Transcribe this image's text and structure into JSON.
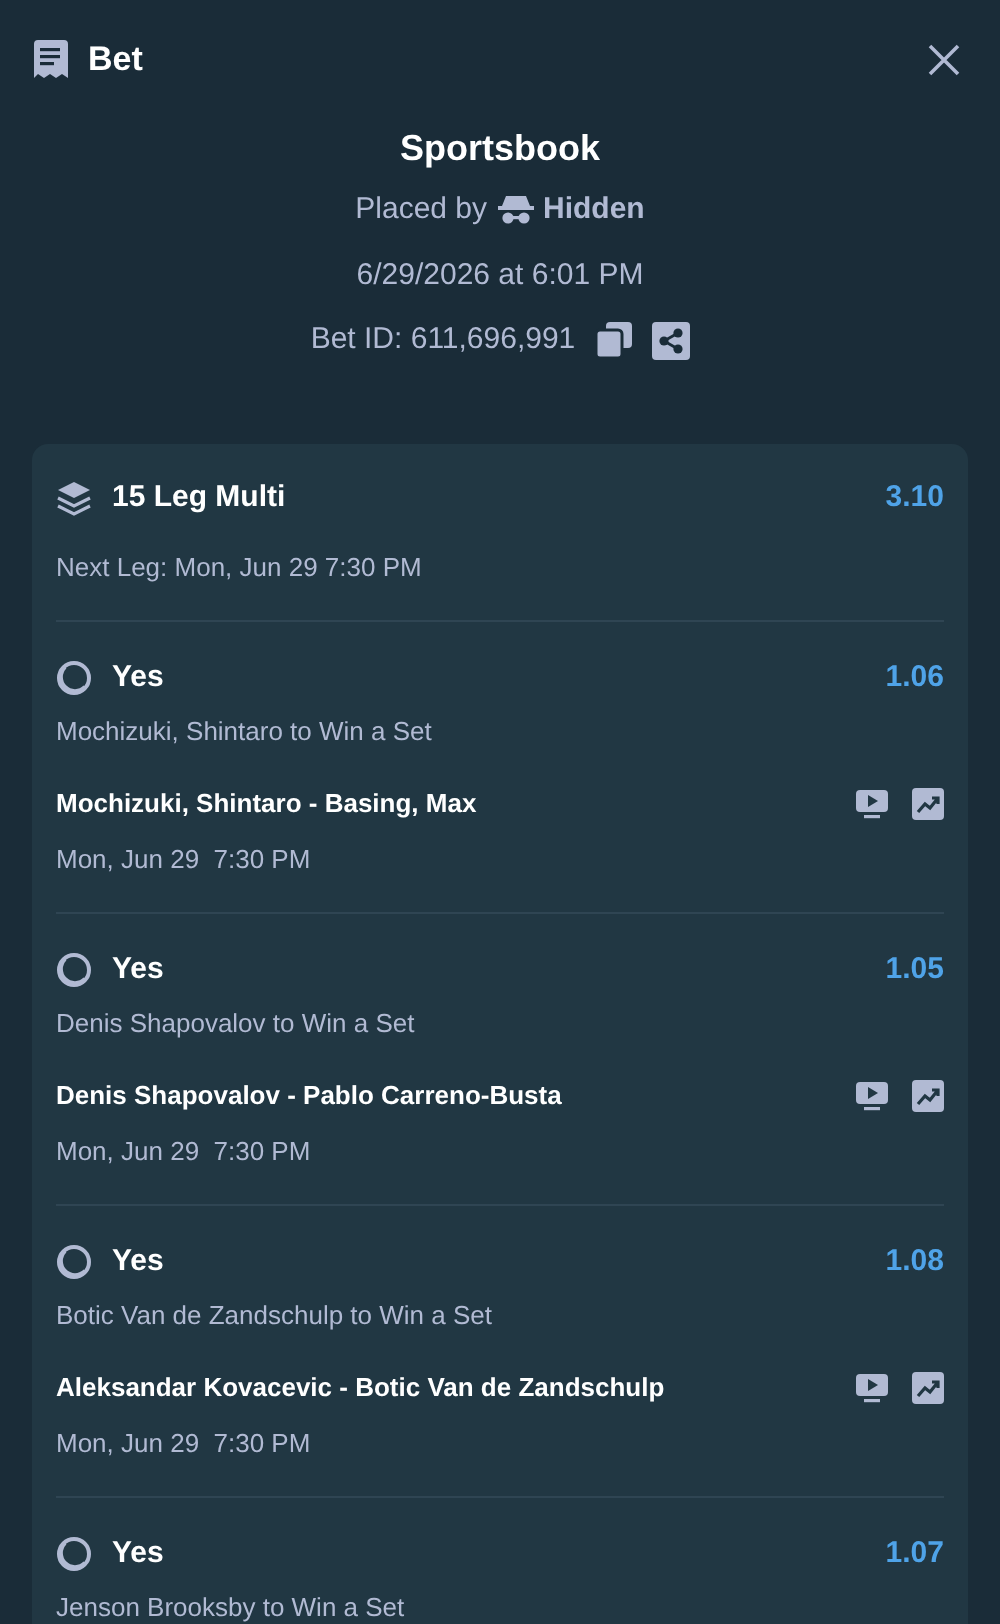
{
  "header": {
    "title": "Bet"
  },
  "summary": {
    "title": "Sportsbook",
    "placed_by_label": "Placed by",
    "placed_by_name": "Hidden",
    "date": "6/29/2026 at 6:01 PM",
    "bet_id": "Bet ID: 611,696,991"
  },
  "multi": {
    "title": "15 Leg Multi",
    "odds": "3.10",
    "next_leg": "Next Leg: Mon, Jun 29 7:30 PM"
  },
  "legs": [
    {
      "outcome": "Yes",
      "odds": "1.06",
      "market": "Mochizuki, Shintaro to Win a Set",
      "match": "Mochizuki, Shintaro - Basing, Max",
      "time": "Mon, Jun 29  7:30 PM"
    },
    {
      "outcome": "Yes",
      "odds": "1.05",
      "market": "Denis Shapovalov to Win a Set",
      "match": "Denis Shapovalov - Pablo Carreno-Busta",
      "time": "Mon, Jun 29  7:30 PM"
    },
    {
      "outcome": "Yes",
      "odds": "1.08",
      "market": "Botic Van de Zandschulp to Win a Set",
      "match": "Aleksandar Kovacevic - Botic Van de Zandschulp",
      "time": "Mon, Jun 29  7:30 PM"
    },
    {
      "outcome": "Yes",
      "odds": "1.07",
      "market": "Jenson Brooksby to Win a Set"
    }
  ]
}
